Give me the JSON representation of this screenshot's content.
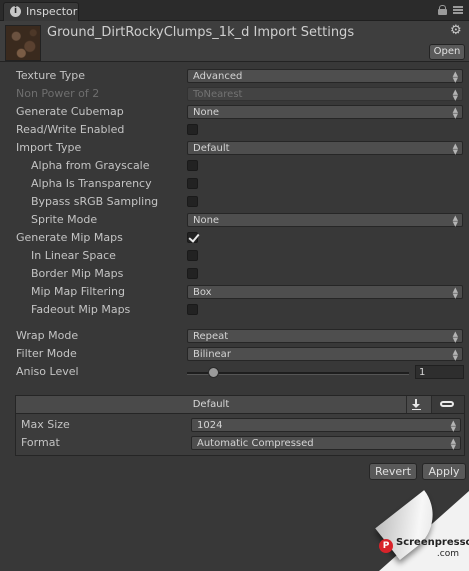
{
  "tab": {
    "label": "Inspector"
  },
  "header": {
    "title": "Ground_DirtRockyClumps_1k_d Import Settings",
    "open_label": "Open"
  },
  "settings": {
    "texture_type": {
      "label": "Texture Type",
      "value": "Advanced"
    },
    "non_power_of_2": {
      "label": "Non Power of 2",
      "value": "ToNearest",
      "disabled": true
    },
    "generate_cubemap": {
      "label": "Generate Cubemap",
      "value": "None"
    },
    "read_write_enabled": {
      "label": "Read/Write Enabled",
      "checked": false
    },
    "import_type": {
      "label": "Import Type",
      "value": "Default"
    },
    "alpha_from_grayscale": {
      "label": "Alpha from Grayscale",
      "checked": false
    },
    "alpha_is_transparency": {
      "label": "Alpha Is Transparency",
      "checked": false
    },
    "bypass_srgb": {
      "label": "Bypass sRGB Sampling",
      "checked": false
    },
    "sprite_mode": {
      "label": "Sprite Mode",
      "value": "None"
    },
    "generate_mip_maps": {
      "label": "Generate Mip Maps",
      "checked": true
    },
    "in_linear_space": {
      "label": "In Linear Space",
      "checked": false
    },
    "border_mip_maps": {
      "label": "Border Mip Maps",
      "checked": false
    },
    "mip_map_filtering": {
      "label": "Mip Map Filtering",
      "value": "Box"
    },
    "fadeout_mip_maps": {
      "label": "Fadeout Mip Maps",
      "checked": false
    },
    "wrap_mode": {
      "label": "Wrap Mode",
      "value": "Repeat"
    },
    "filter_mode": {
      "label": "Filter Mode",
      "value": "Bilinear"
    },
    "aniso_level": {
      "label": "Aniso Level",
      "value": "1"
    }
  },
  "platform": {
    "tab_label": "Default",
    "max_size": {
      "label": "Max Size",
      "value": "1024"
    },
    "format": {
      "label": "Format",
      "value": "Automatic Compressed"
    }
  },
  "actions": {
    "revert_label": "Revert",
    "apply_label": "Apply"
  },
  "watermark": {
    "name": "Screenpresso",
    "domain": ".com"
  }
}
